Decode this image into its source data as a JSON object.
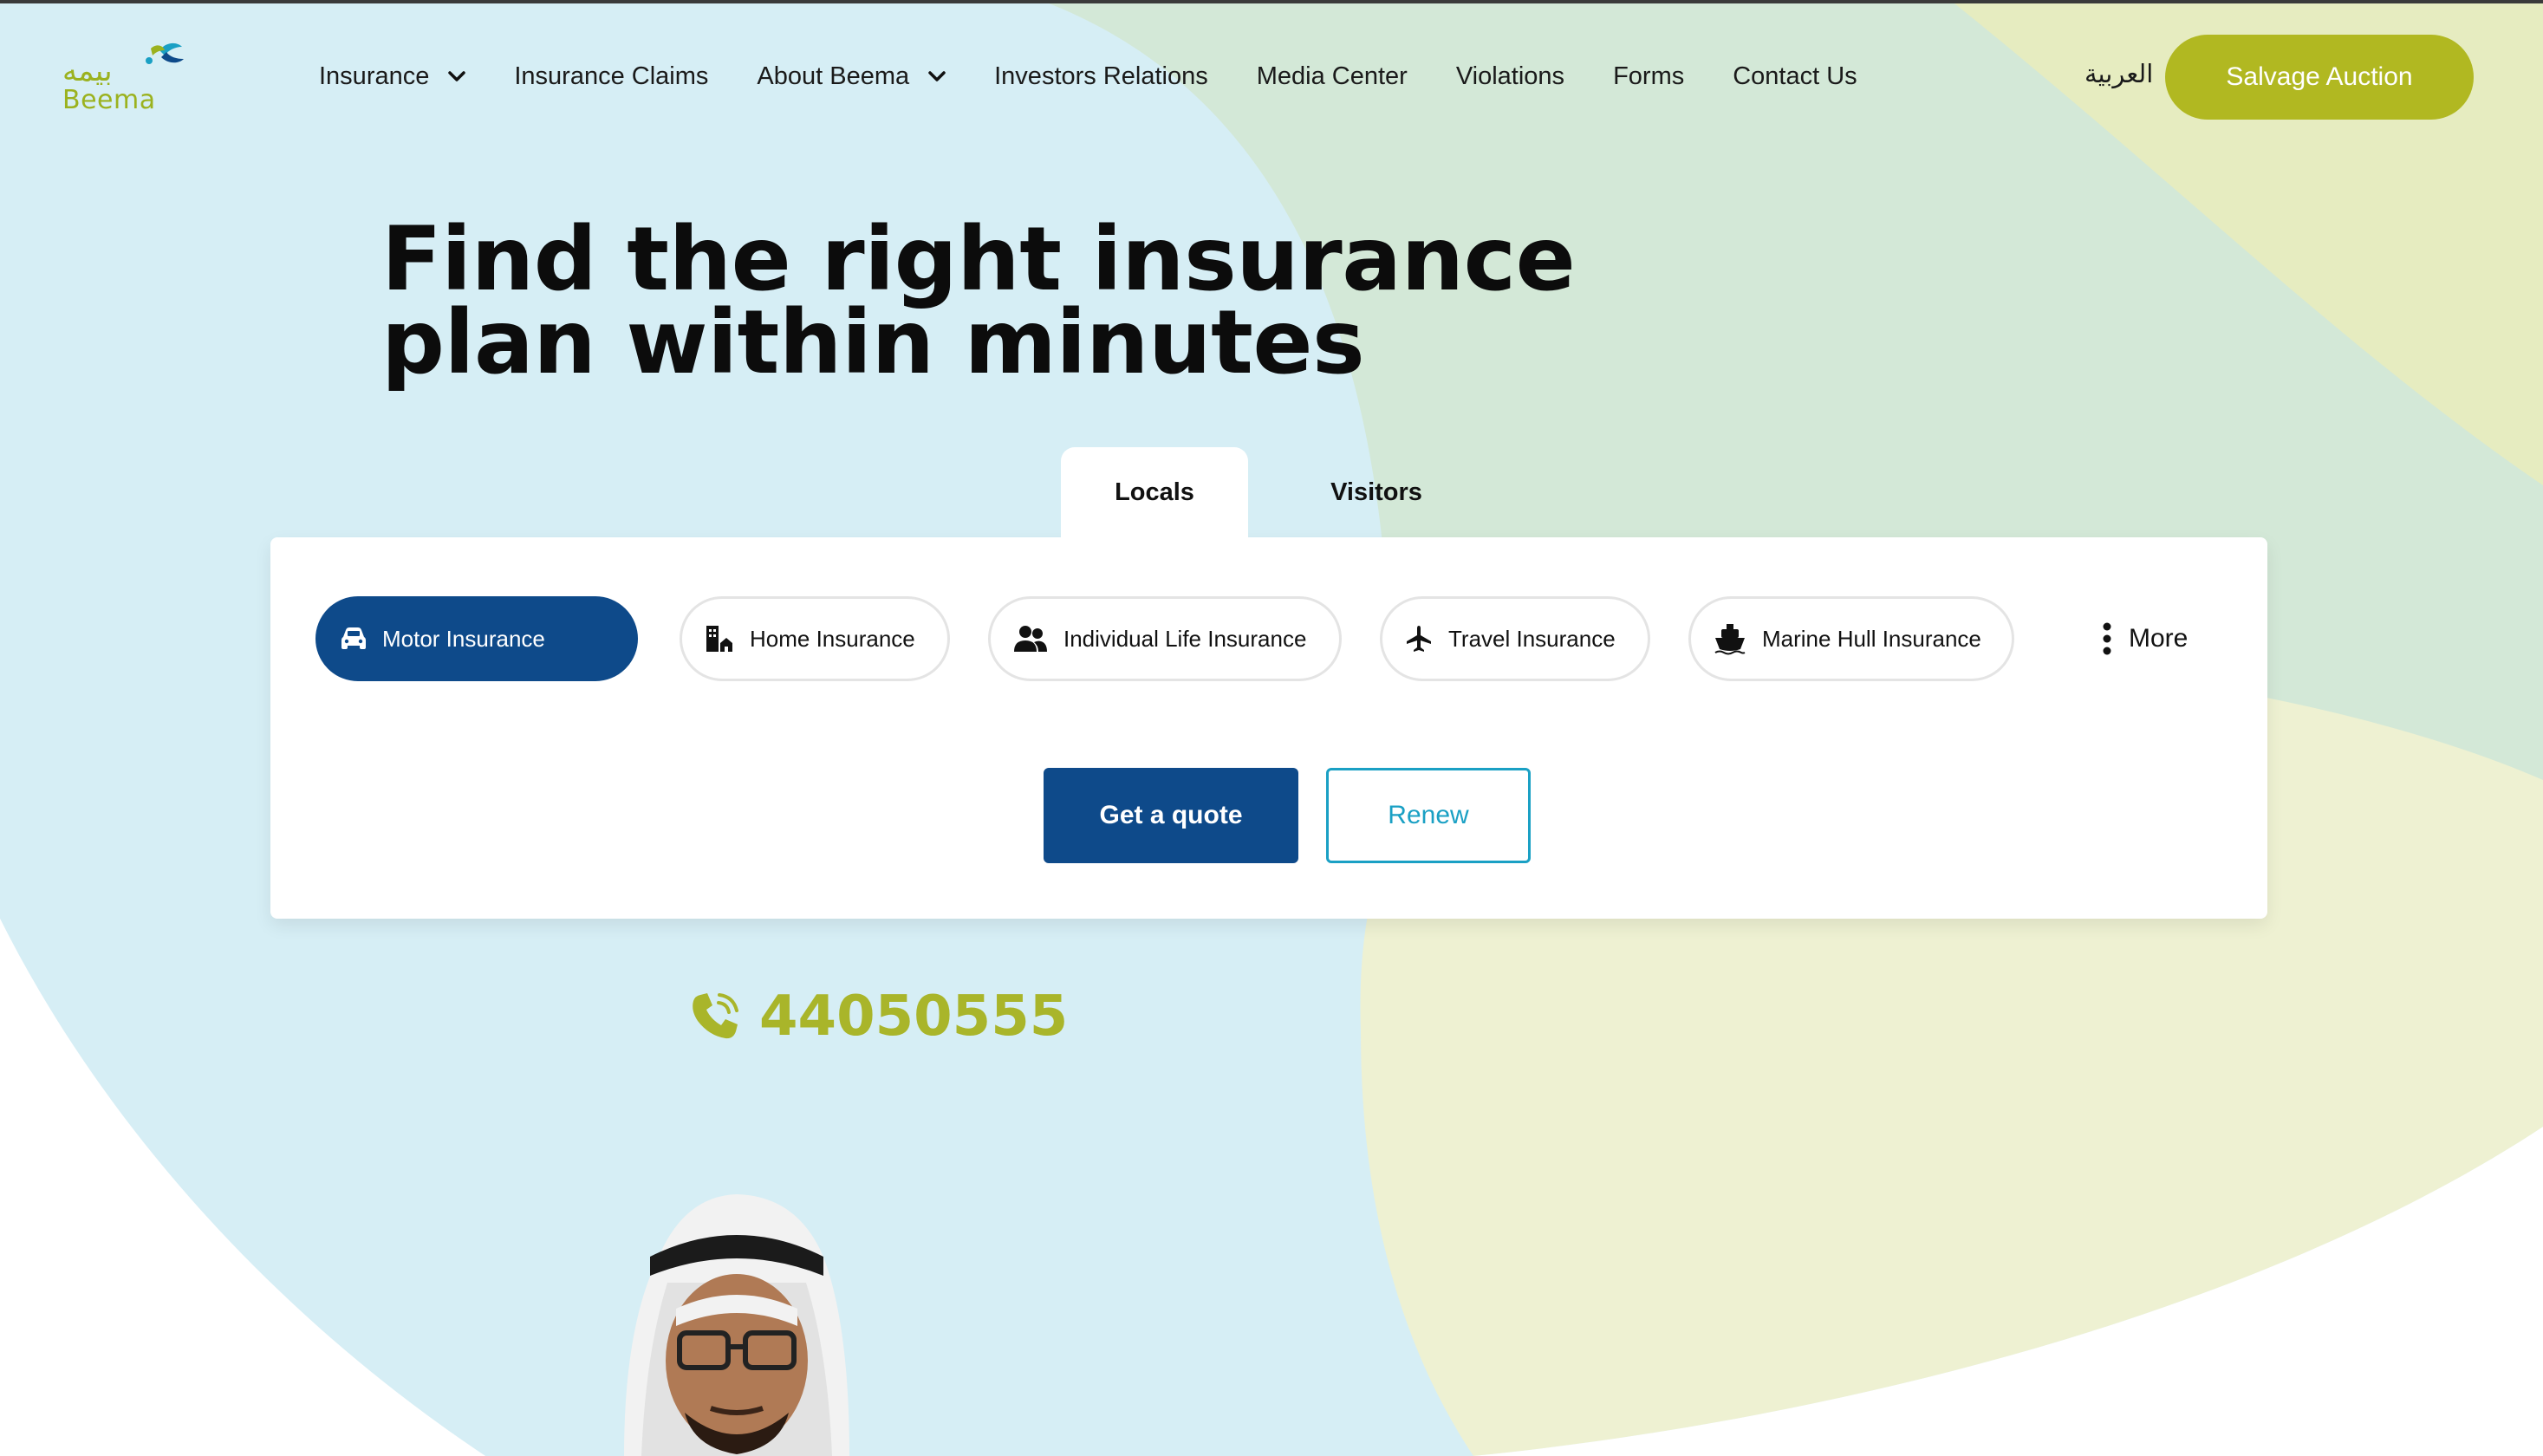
{
  "brand": {
    "logo_text": "Beema",
    "logo_arabic": "بيمه",
    "primary_color": "#0e4a8a",
    "accent_color": "#b1b821",
    "renew_color": "#1aa0c4"
  },
  "nav": {
    "items": [
      {
        "label": "Insurance",
        "has_dropdown": true
      },
      {
        "label": "Insurance Claims",
        "has_dropdown": false
      },
      {
        "label": "About Beema",
        "has_dropdown": true
      },
      {
        "label": "Investors Relations",
        "has_dropdown": false
      },
      {
        "label": "Media Center",
        "has_dropdown": false
      },
      {
        "label": "Violations",
        "has_dropdown": false
      },
      {
        "label": "Forms",
        "has_dropdown": false
      },
      {
        "label": "Contact Us",
        "has_dropdown": false
      }
    ],
    "language": "العربية",
    "cta": "Salvage Auction"
  },
  "hero": {
    "title_line1": "Find the right insurance",
    "title_line2": "plan within minutes"
  },
  "tabs": [
    {
      "label": "Locals",
      "active": true
    },
    {
      "label": "Visitors",
      "active": false
    }
  ],
  "insurance_types": [
    {
      "label": "Motor Insurance",
      "icon": "car-icon",
      "active": true
    },
    {
      "label": "Home Insurance",
      "icon": "home-icon",
      "active": false
    },
    {
      "label": "Individual Life Insurance",
      "icon": "people-icon",
      "active": false
    },
    {
      "label": "Travel Insurance",
      "icon": "plane-icon",
      "active": false
    },
    {
      "label": "Marine Hull Insurance",
      "icon": "ship-icon",
      "active": false
    }
  ],
  "more_label": "More",
  "actions": {
    "quote": "Get a quote",
    "renew": "Renew"
  },
  "contact": {
    "phone": "44050555"
  }
}
